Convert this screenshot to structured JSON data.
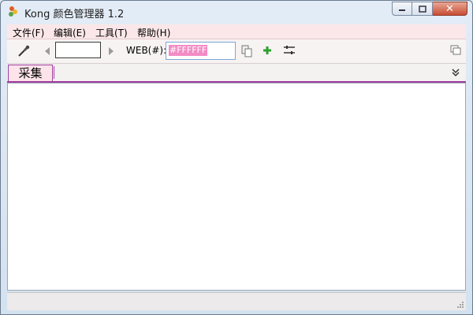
{
  "window": {
    "title": "Kong 颜色管理器 1.2"
  },
  "menu": {
    "items": [
      "文件(F)",
      "编辑(E)",
      "工具(T)",
      "帮助(H)"
    ]
  },
  "toolbar": {
    "web_label": "WEB(#):",
    "web_value": "#FFFFFF",
    "swatch_color": "#FFFFFF"
  },
  "tabs": [
    "采集"
  ],
  "icons": [
    "app-icon",
    "minimize-icon",
    "maximize-icon",
    "close-icon",
    "eyedropper-icon",
    "arrow-left-icon",
    "arrow-right-icon",
    "copy-icon",
    "add-icon",
    "adjust-icon",
    "window-icon",
    "expand-icon",
    "resize-grip-icon"
  ],
  "colors": {
    "accent": "#A23EA0",
    "menu_bg": "#FBE7E9",
    "highlight": "#F38BC4",
    "close": "#C84D32"
  }
}
